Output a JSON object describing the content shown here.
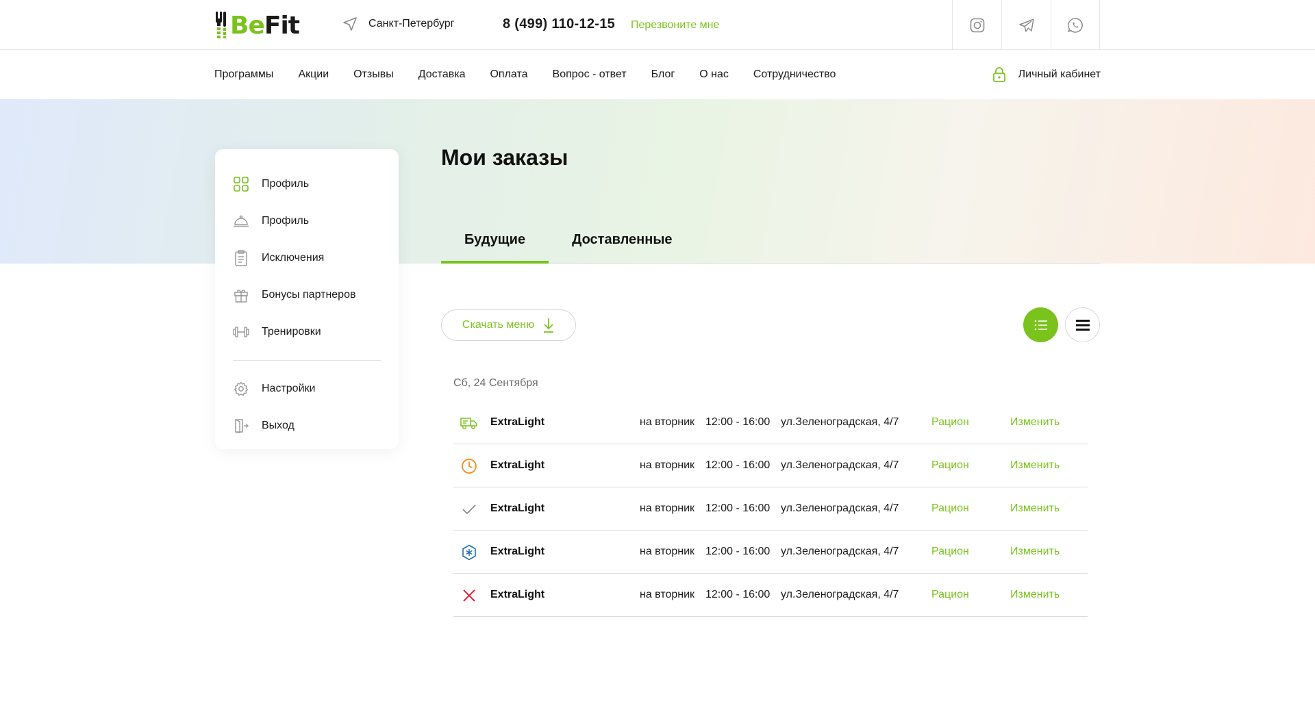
{
  "header": {
    "logo_text_be": "Be",
    "logo_text_fit": "Fit",
    "city": "Санкт-Петербург",
    "phone": "8 (499) 110-12-15",
    "callback": "Перезвоните мне",
    "socials": [
      "instagram-icon",
      "telegram-icon",
      "whatsapp-icon"
    ]
  },
  "nav": {
    "items": [
      "Программы",
      "Акции",
      "Отзывы",
      "Доставка",
      "Оплата",
      "Вопрос - ответ",
      "Блог",
      "О нас",
      "Сотрудничество"
    ],
    "cabinet": "Личный кабинет"
  },
  "sidebar": {
    "items": [
      {
        "label": "Профиль",
        "icon": "grid-icon"
      },
      {
        "label": "Профиль",
        "icon": "cloche-icon"
      },
      {
        "label": "Исключения",
        "icon": "clipboard-icon"
      },
      {
        "label": "Бонусы партнеров",
        "icon": "gift-icon"
      },
      {
        "label": "Тренировки",
        "icon": "dumbbell-icon"
      }
    ],
    "bottom_items": [
      {
        "label": "Настройки",
        "icon": "gear-icon"
      },
      {
        "label": "Выход",
        "icon": "exit-icon"
      }
    ]
  },
  "main": {
    "title": "Мои заказы",
    "tabs": [
      {
        "label": "Будущие",
        "active": true
      },
      {
        "label": "Доставленные",
        "active": false
      }
    ],
    "download_label": "Скачать меню",
    "date_label": "Сб, 24 Сентября",
    "orders": [
      {
        "status": "delivery",
        "name": "ExtraLight",
        "day": "на вторник",
        "time": "12:00 - 16:00",
        "address": "ул.Зеленоградская, 4/7",
        "ration": "Рацион",
        "edit": "Изменить"
      },
      {
        "status": "pending",
        "name": "ExtraLight",
        "day": "на вторник",
        "time": "12:00 - 16:00",
        "address": "ул.Зеленоградская, 4/7",
        "ration": "Рацион",
        "edit": "Изменить"
      },
      {
        "status": "done",
        "name": "ExtraLight",
        "day": "на вторник",
        "time": "12:00 - 16:00",
        "address": "ул.Зеленоградская, 4/7",
        "ration": "Рацион",
        "edit": "Изменить"
      },
      {
        "status": "frozen",
        "name": "ExtraLight",
        "day": "на вторник",
        "time": "12:00 - 16:00",
        "address": "ул.Зеленоградская, 4/7",
        "ration": "Рацион",
        "edit": "Изменить"
      },
      {
        "status": "cancelled",
        "name": "ExtraLight",
        "day": "на вторник",
        "time": "12:00 - 16:00",
        "address": "ул.Зеленоградская, 4/7",
        "ration": "Рацион",
        "edit": "Изменить"
      }
    ]
  },
  "colors": {
    "accent": "#7ac31c",
    "pending": "#f28c18",
    "frozen": "#1f6fb2",
    "cancelled": "#e3263a"
  }
}
